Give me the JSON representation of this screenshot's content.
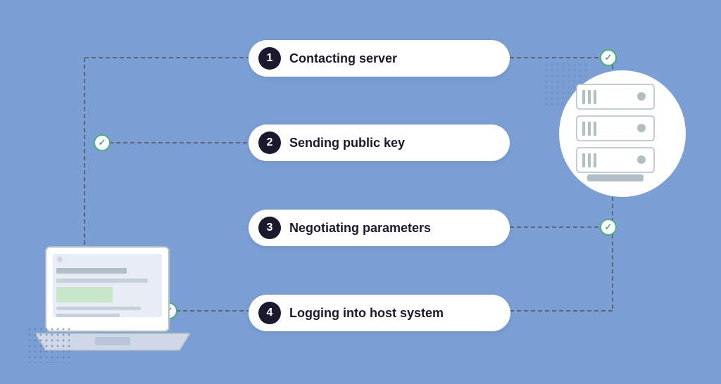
{
  "background_color": "#7b9fd4",
  "steps": [
    {
      "number": "1",
      "label": "Contacting server",
      "id": "step1"
    },
    {
      "number": "2",
      "label": "Sending public key",
      "id": "step2"
    },
    {
      "number": "3",
      "label": "Negotiating parameters",
      "id": "step3"
    },
    {
      "number": "4",
      "label": "Logging into host system",
      "id": "step4"
    }
  ],
  "icons": {
    "check": "✓",
    "server": "server-icon",
    "laptop": "laptop-icon"
  }
}
